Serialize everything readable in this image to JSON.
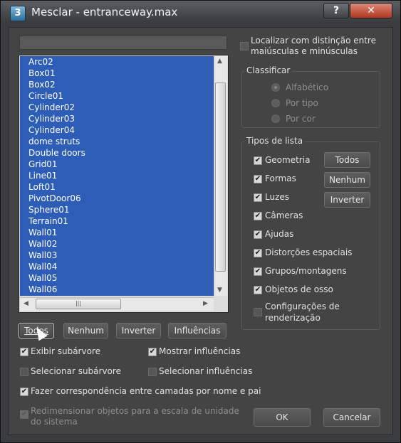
{
  "window": {
    "icon_glyph": "3",
    "title": "Mesclar - entranceway.max",
    "help_label": "?",
    "close_label": "✕"
  },
  "objects": [
    "Arc02",
    "Box01",
    "Box02",
    "Circle01",
    "Cylinder02",
    "Cylinder03",
    "Cylinder04",
    "dome struts",
    "Double doors",
    "Grid01",
    "Line01",
    "Loft01",
    "PivotDoor06",
    "Sphere01",
    "Terrain01",
    "Wall01",
    "Wall02",
    "Wall03",
    "Wall04",
    "Wall05",
    "Wall06"
  ],
  "list_buttons": {
    "all": "Todos",
    "none": "Nenhum",
    "invert": "Inverter",
    "influences": "Influências"
  },
  "options": {
    "case_sensitive": {
      "label1": "Localizar com distinção entre",
      "label2": "maiúsculas e minúsculas",
      "checked": false
    },
    "show_subtree": {
      "label": "Exibir subárvore",
      "checked": true
    },
    "show_influences": {
      "label": "Mostrar influências",
      "checked": true
    },
    "select_subtree": {
      "label": "Selecionar subárvore",
      "checked": false
    },
    "select_influences": {
      "label": "Selecionar influências",
      "checked": false
    },
    "match_layers": {
      "label": "Fazer correspondência entre camadas por nome e pai",
      "checked": true
    },
    "rescale": {
      "label1": "Redimensionar objetos para a escala de unidade",
      "label2": "do sistema",
      "checked": true,
      "disabled": true
    }
  },
  "sort": {
    "title": "Classificar",
    "options": [
      "Alfabético",
      "Por tipo",
      "Por cor"
    ],
    "selected": "Alfabético"
  },
  "list_types": {
    "title": "Tipos de lista",
    "items": [
      {
        "label": "Geometria",
        "checked": true
      },
      {
        "label": "Formas",
        "checked": true
      },
      {
        "label": "Luzes",
        "checked": true
      },
      {
        "label": "Câmeras",
        "checked": true
      },
      {
        "label": "Ajudas",
        "checked": true
      },
      {
        "label": "Distorções espaciais",
        "checked": true
      },
      {
        "label": "Grupos/montagens",
        "checked": true
      },
      {
        "label": "Objetos de osso",
        "checked": true
      },
      {
        "label1": "Configurações de",
        "label2": "renderização",
        "checked": false
      }
    ],
    "buttons": {
      "all": "Todos",
      "none": "Nenhum",
      "invert": "Inverter"
    }
  },
  "dialog_buttons": {
    "ok": "OK",
    "cancel": "Cancelar"
  },
  "colors": {
    "selection": "#2e5db7",
    "panel": "#444444"
  }
}
